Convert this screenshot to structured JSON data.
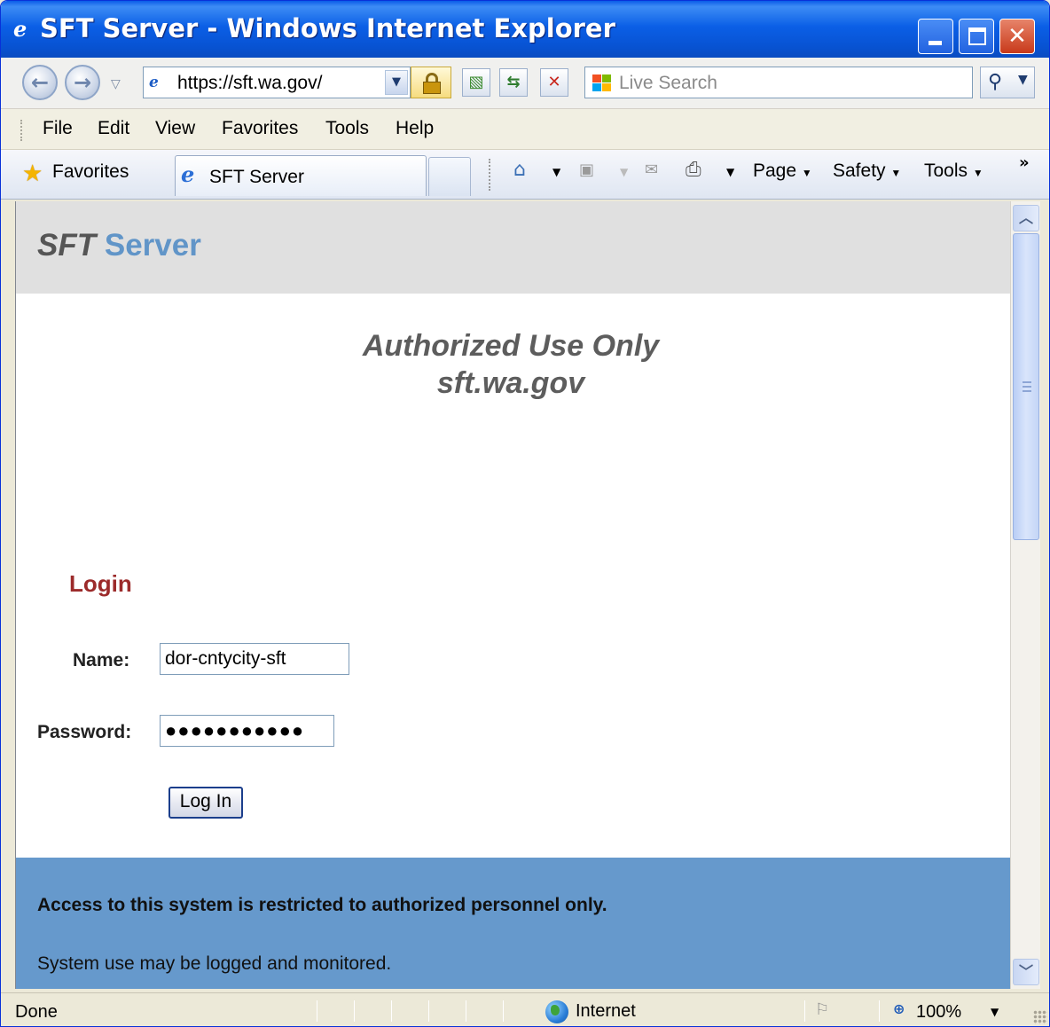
{
  "window": {
    "title": "SFT Server - Windows Internet Explorer"
  },
  "address_bar": {
    "url": "https://sft.wa.gov/",
    "search_placeholder": "Live Search"
  },
  "menu": {
    "items": [
      "File",
      "Edit",
      "View",
      "Favorites",
      "Tools",
      "Help"
    ]
  },
  "favorites_bar": {
    "favorites_label": "Favorites",
    "tab_title": "SFT Server",
    "commands": [
      "Page",
      "Safety",
      "Tools"
    ]
  },
  "page": {
    "brand_sft": "SFT",
    "brand_server": "Server",
    "authorized_line1": "Authorized Use Only",
    "authorized_line2": "sft.wa.gov",
    "login_heading": "Login",
    "name_label": "Name:",
    "name_value": "dor-cntycity-sft",
    "password_label": "Password:",
    "password_value": "●●●●●●●●●●●",
    "login_button": "Log In",
    "footer_notice": "Access to this system is restricted to authorized personnel only.",
    "footer_monitor": "System use may be logged and monitored."
  },
  "status_bar": {
    "status": "Done",
    "zone": "Internet",
    "zoom": "100%"
  },
  "colors": {
    "titlebar": "#0853d3",
    "header_bg": "#e0e0e0",
    "brand_accent": "#6195c8",
    "login_heading": "#9c2b2b",
    "footer_bg": "#6699cc"
  }
}
